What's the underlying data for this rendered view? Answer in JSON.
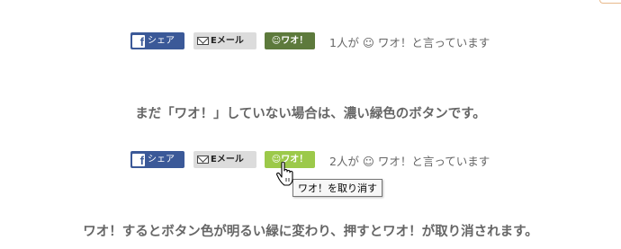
{
  "row1": {
    "share_label": "シェア",
    "email_label": "Eメール",
    "wao_label": "☺ワオ！",
    "count_text": "1人が ☺ ワオ！と言っています"
  },
  "caption1": "まだ「ワオ！」していない場合は、濃い緑色のボタンです。",
  "row2": {
    "share_label": "シェア",
    "email_label": "Eメール",
    "wao_label": "☺ワオ！",
    "count_text": "2人が ☺ ワオ！と言っています"
  },
  "tooltip": "ワオ！を取り消す",
  "caption2": "ワオ！するとボタン色が明るい緑に変わり、押すとワオ！が取り消されます。",
  "colors": {
    "facebook": "#3b5998",
    "wao_dark": "#5d7a3c",
    "wao_light": "#9cc94a",
    "email_bg": "#dcdcdc"
  },
  "icons": [
    "facebook-icon",
    "envelope-icon",
    "smiley-icon",
    "hand-cursor-icon"
  ]
}
